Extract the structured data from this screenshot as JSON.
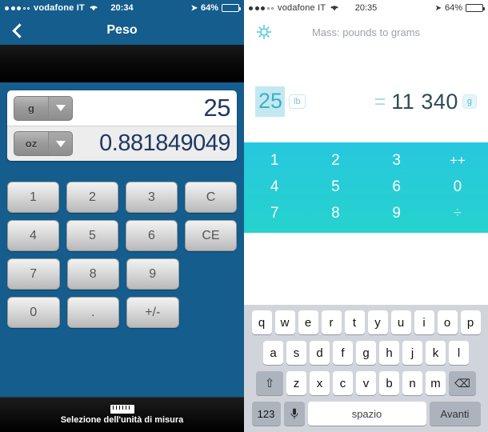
{
  "left": {
    "status": {
      "signal_dots_filled": 3,
      "signal_dots_empty": 2,
      "carrier": "vodafone IT",
      "wifi_icon": "wifi-icon",
      "time": "20:34",
      "location_icon": "location-arrow-icon",
      "battery_percent": "64%"
    },
    "nav": {
      "back_icon": "chevron-left-icon",
      "title": "Peso"
    },
    "display": {
      "from_unit": "g",
      "from_value": "25",
      "to_unit": "oz",
      "to_value": "0.881849049",
      "dropdown_icon": "caret-down-icon"
    },
    "keypad": [
      [
        "1",
        "2",
        "3",
        "C"
      ],
      [
        "4",
        "5",
        "6",
        "CE"
      ],
      [
        "7",
        "8",
        "9",
        ""
      ],
      [
        "0",
        ".",
        "+/-",
        ""
      ]
    ],
    "tabbar": {
      "icon": "ruler-icon",
      "label": "Selezione dell'unità di misura"
    }
  },
  "right": {
    "status": {
      "signal_dots_filled": 3,
      "signal_dots_empty": 2,
      "carrier": "vodafone IT",
      "wifi_icon": "wifi-icon",
      "time": "20:35",
      "location_icon": "location-arrow-icon",
      "battery_percent": "64%"
    },
    "header": {
      "settings_icon": "gear-icon",
      "title": "Mass: pounds to grams"
    },
    "result": {
      "input_value": "25",
      "input_unit": "lb",
      "equals": "=",
      "output_value": "11 340",
      "output_unit": "g"
    },
    "numpad": [
      [
        "1",
        "2",
        "3",
        "++"
      ],
      [
        "4",
        "5",
        "6",
        "0"
      ],
      [
        "7",
        "8",
        "9",
        "÷"
      ]
    ],
    "keyboard": {
      "row1": [
        "q",
        "w",
        "e",
        "r",
        "t",
        "y",
        "u",
        "i",
        "o",
        "p"
      ],
      "row2": [
        "a",
        "s",
        "d",
        "f",
        "g",
        "h",
        "j",
        "k",
        "l"
      ],
      "row3_letters": [
        "z",
        "x",
        "c",
        "v",
        "b",
        "n",
        "m"
      ],
      "shift_icon": "shift-arrow-icon",
      "backspace_icon": "backspace-icon",
      "numbers_key": "123",
      "mic_icon": "microphone-icon",
      "space_key": "spazio",
      "next_key": "Avanti"
    }
  },
  "colors": {
    "left_blue": "#145D8C",
    "cyan": "#27C7DE",
    "input_highlight": "#C3E9F0",
    "keyboard_gray": "#D1D5DB"
  }
}
